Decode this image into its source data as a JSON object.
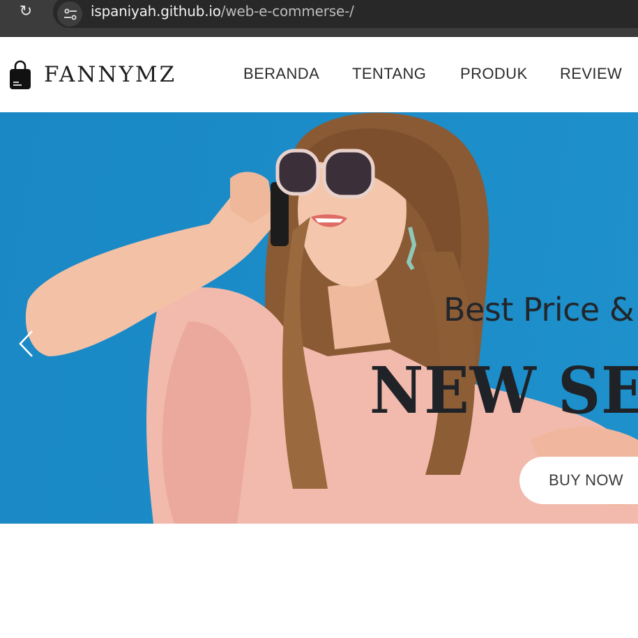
{
  "browser": {
    "url_host": "ispaniyah.github.io",
    "url_path": "/web-e-commerse-/",
    "reload_icon": "reload-icon",
    "site_info_icon": "tune-icon"
  },
  "header": {
    "logo_icon": "shopping-bag-icon",
    "brand": "FANNYMZ",
    "nav": [
      {
        "label": "BERANDA"
      },
      {
        "label": "TENTANG"
      },
      {
        "label": "PRODUK"
      },
      {
        "label": "REVIEW"
      }
    ]
  },
  "hero": {
    "tagline": "Best Price &",
    "headline": "NEW SEA",
    "button_label": "BUY NOW",
    "prev_icon": "chevron-left-icon",
    "image": "model-with-sunglasses-on-phone",
    "background_color": "#1b8cc8"
  }
}
